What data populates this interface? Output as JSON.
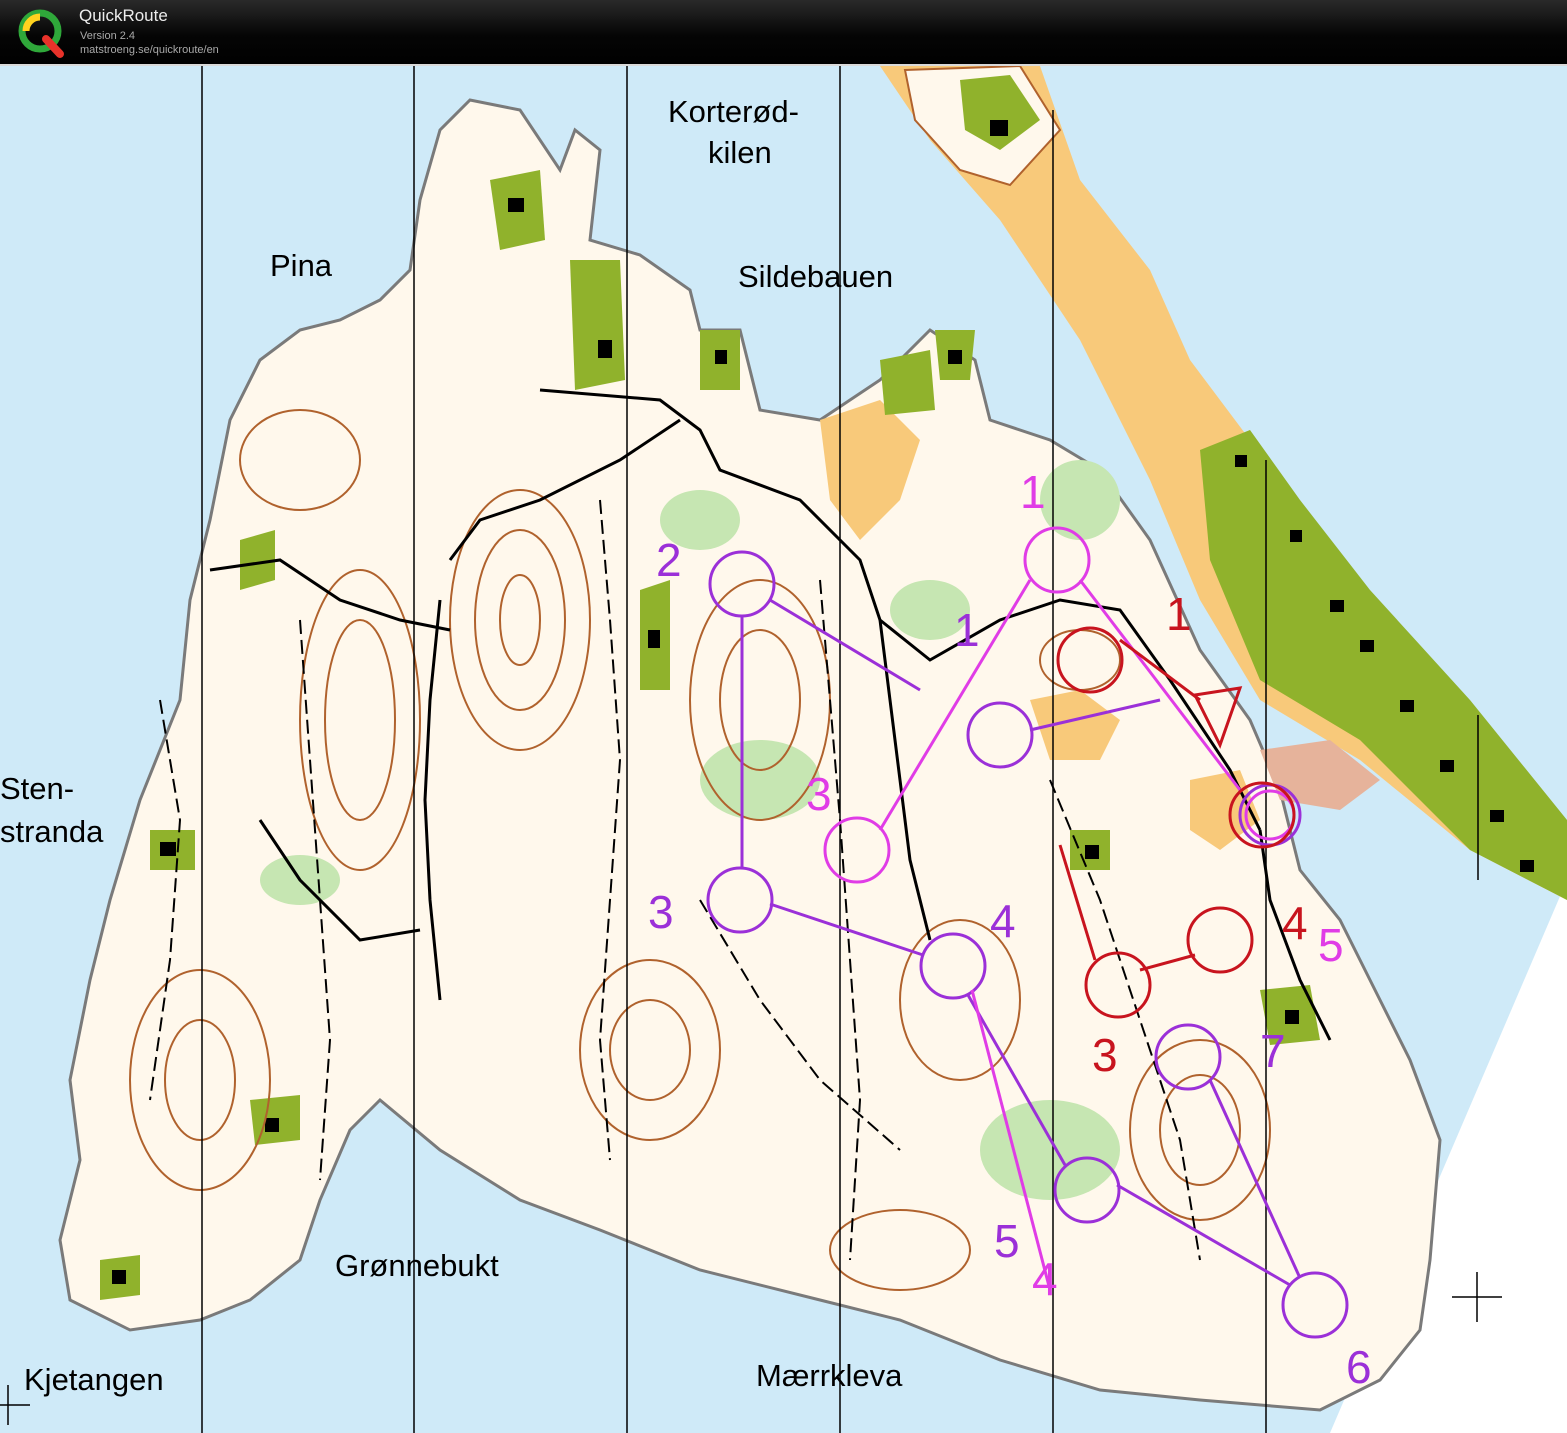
{
  "app": {
    "title": "QuickRoute",
    "version": "Version 2.4",
    "url": "matstroeng.se/quickroute/en"
  },
  "map": {
    "place_names": {
      "korterod": [
        "Korterød-",
        "kilen"
      ],
      "pina": "Pina",
      "sildebauen": "Sildebauen",
      "stenstranda": [
        "Sten-",
        "stranda"
      ],
      "gronnebukt": "Grønnebukt",
      "kjetangen": "Kjetangen",
      "maerrkleva": "Mærrkleva"
    },
    "colors": {
      "water": "#cfeaf8",
      "forest": "#ffffff",
      "open_land": "#f8c97a",
      "vegetation_green": "#a9d88d",
      "dark_green": "#90b22c",
      "contours": "#b0622d",
      "course_purple": "#9b30d8",
      "course_magenta": "#e03ce6",
      "course_red": "#c8141e"
    },
    "control_numbers": {
      "purple": [
        "2",
        "3",
        "1",
        "4",
        "5",
        "7",
        "6"
      ],
      "magenta": [
        "1",
        "3",
        "4",
        "5"
      ],
      "red": [
        "1",
        "4",
        "3"
      ]
    }
  }
}
